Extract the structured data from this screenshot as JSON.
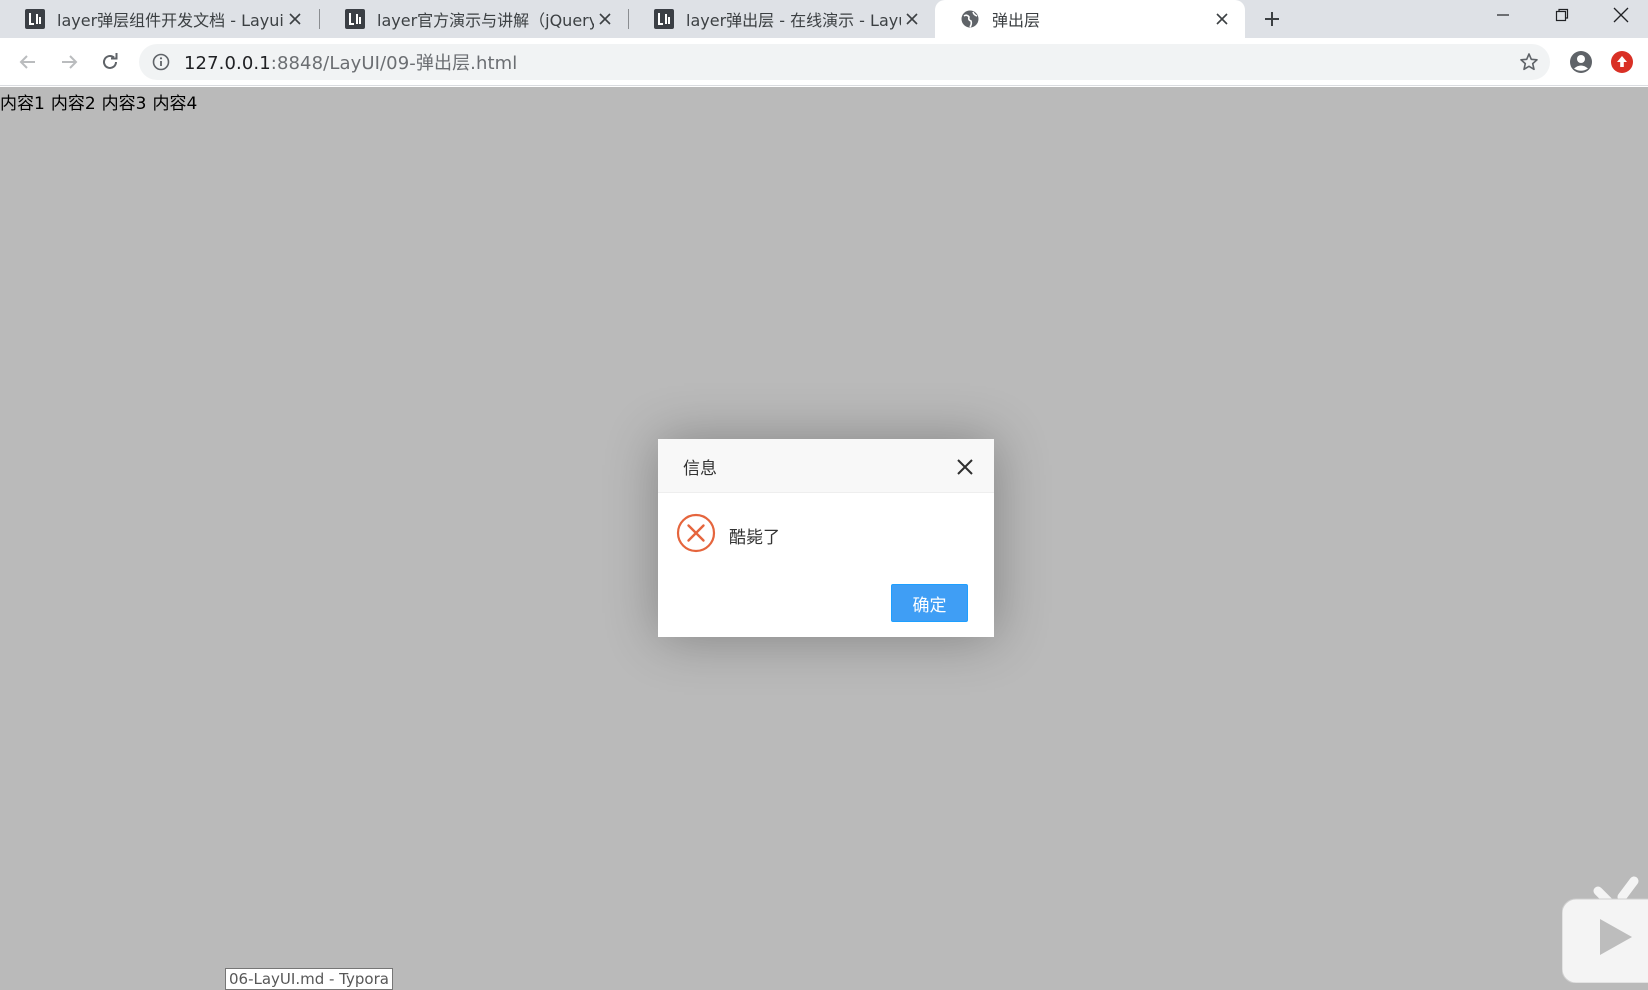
{
  "browser": {
    "tabs": [
      {
        "title": "layer弹层组件开发文档 - Layui",
        "favicon": "layui-logo-icon",
        "active": false
      },
      {
        "title": "layer官方演示与讲解（jQuery弹",
        "favicon": "layui-logo-icon",
        "active": false
      },
      {
        "title": "layer弹出层 - 在线演示 - Layui",
        "favicon": "layui-logo-icon",
        "active": false
      },
      {
        "title": "弹出层",
        "favicon": "globe-icon",
        "active": true
      }
    ],
    "url_host": "127.0.0.1",
    "url_rest": ":8848/LayUI/09-弹出层.html"
  },
  "page": {
    "contents": [
      "内容1",
      "内容2",
      "内容3",
      "内容4"
    ]
  },
  "dialog": {
    "title": "信息",
    "message": "酷毙了",
    "icon": "error-icon",
    "confirm_label": "确定",
    "accent_color": "#1e9fff",
    "error_color": "#e5653d"
  },
  "taskbar_tooltip": "06-LayUI.md - Typora"
}
